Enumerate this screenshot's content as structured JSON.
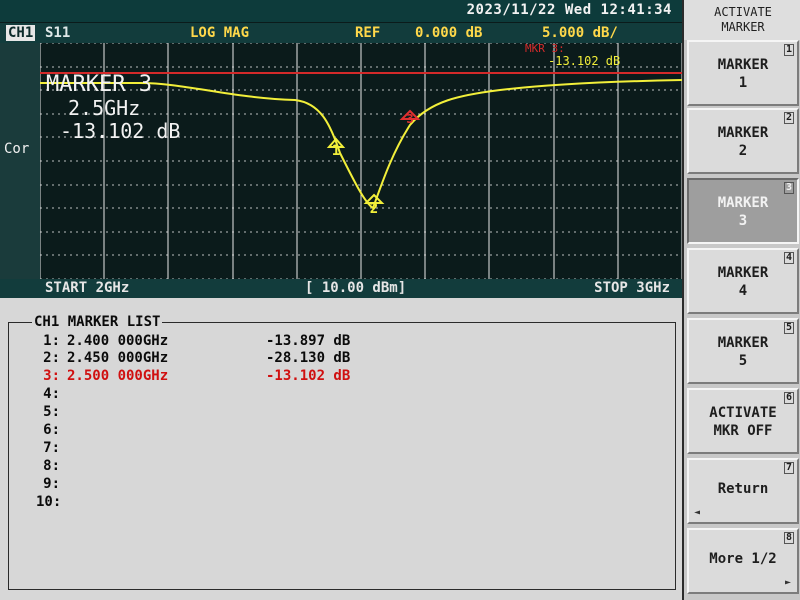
{
  "titlebar": {
    "datetime": "2023/11/22 Wed 12:41:34"
  },
  "header": {
    "channel": "CH1",
    "parameter": "S11",
    "format": "LOG MAG",
    "ref_label": "REF",
    "ref_value": "0.000 dB",
    "scale": "5.000 dB/"
  },
  "plot": {
    "left_label": "Cor",
    "marker_readout": {
      "corner_label": "MKR 3:",
      "corner_value": "-13.102 dB",
      "title": "MARKER 3",
      "freq": "2.5GHz",
      "value": "-13.102 dB"
    },
    "markers": [
      {
        "id": "1",
        "label": "1",
        "freq_ghz": 2.4,
        "db": -13.897,
        "color": "#f2ef3a"
      },
      {
        "id": "2",
        "label": "2",
        "freq_ghz": 2.45,
        "db": -28.13,
        "color": "#f2ef3a"
      },
      {
        "id": "3",
        "label": "3",
        "freq_ghz": 2.5,
        "db": -13.102,
        "color": "#e03030"
      }
    ]
  },
  "bottom_axis": {
    "start": "START 2GHz",
    "power": "[ 10.00 dBm]",
    "stop": "STOP 3GHz"
  },
  "marker_list": {
    "title": "CH1 MARKER LIST",
    "rows": [
      {
        "idx": "1:",
        "freq": "2.400 000GHz",
        "value": "-13.897 dB",
        "active": false
      },
      {
        "idx": "2:",
        "freq": "2.450 000GHz",
        "value": "-28.130 dB",
        "active": false
      },
      {
        "idx": "3:",
        "freq": "2.500 000GHz",
        "value": "-13.102 dB",
        "active": true
      },
      {
        "idx": "4:",
        "freq": "",
        "value": "",
        "active": false
      },
      {
        "idx": "5:",
        "freq": "",
        "value": "",
        "active": false
      },
      {
        "idx": "6:",
        "freq": "",
        "value": "",
        "active": false
      },
      {
        "idx": "7:",
        "freq": "",
        "value": "",
        "active": false
      },
      {
        "idx": "8:",
        "freq": "",
        "value": "",
        "active": false
      },
      {
        "idx": "9:",
        "freq": "",
        "value": "",
        "active": false
      },
      {
        "idx": "10:",
        "freq": "",
        "value": "",
        "active": false
      }
    ]
  },
  "softkeys": {
    "title": "ACTIVATE\nMARKER",
    "items": [
      {
        "label": "MARKER\n1",
        "num": "1",
        "pressed": false
      },
      {
        "label": "MARKER\n2",
        "num": "2",
        "pressed": false
      },
      {
        "label": "MARKER\n3",
        "num": "3",
        "pressed": true
      },
      {
        "label": "MARKER\n4",
        "num": "4",
        "pressed": false
      },
      {
        "label": "MARKER\n5",
        "num": "5",
        "pressed": false
      },
      {
        "label": "ACTIVATE\nMKR OFF",
        "num": "6",
        "pressed": false
      },
      {
        "label": "Return",
        "num": "7",
        "pressed": false,
        "arrow": "left"
      },
      {
        "label": "More 1/2",
        "num": "8",
        "pressed": false,
        "arrow": "right"
      }
    ]
  },
  "colors": {
    "trace": "#f2ef3a",
    "grid": "#e8e8e8",
    "ref_line": "#d42a2a"
  }
}
